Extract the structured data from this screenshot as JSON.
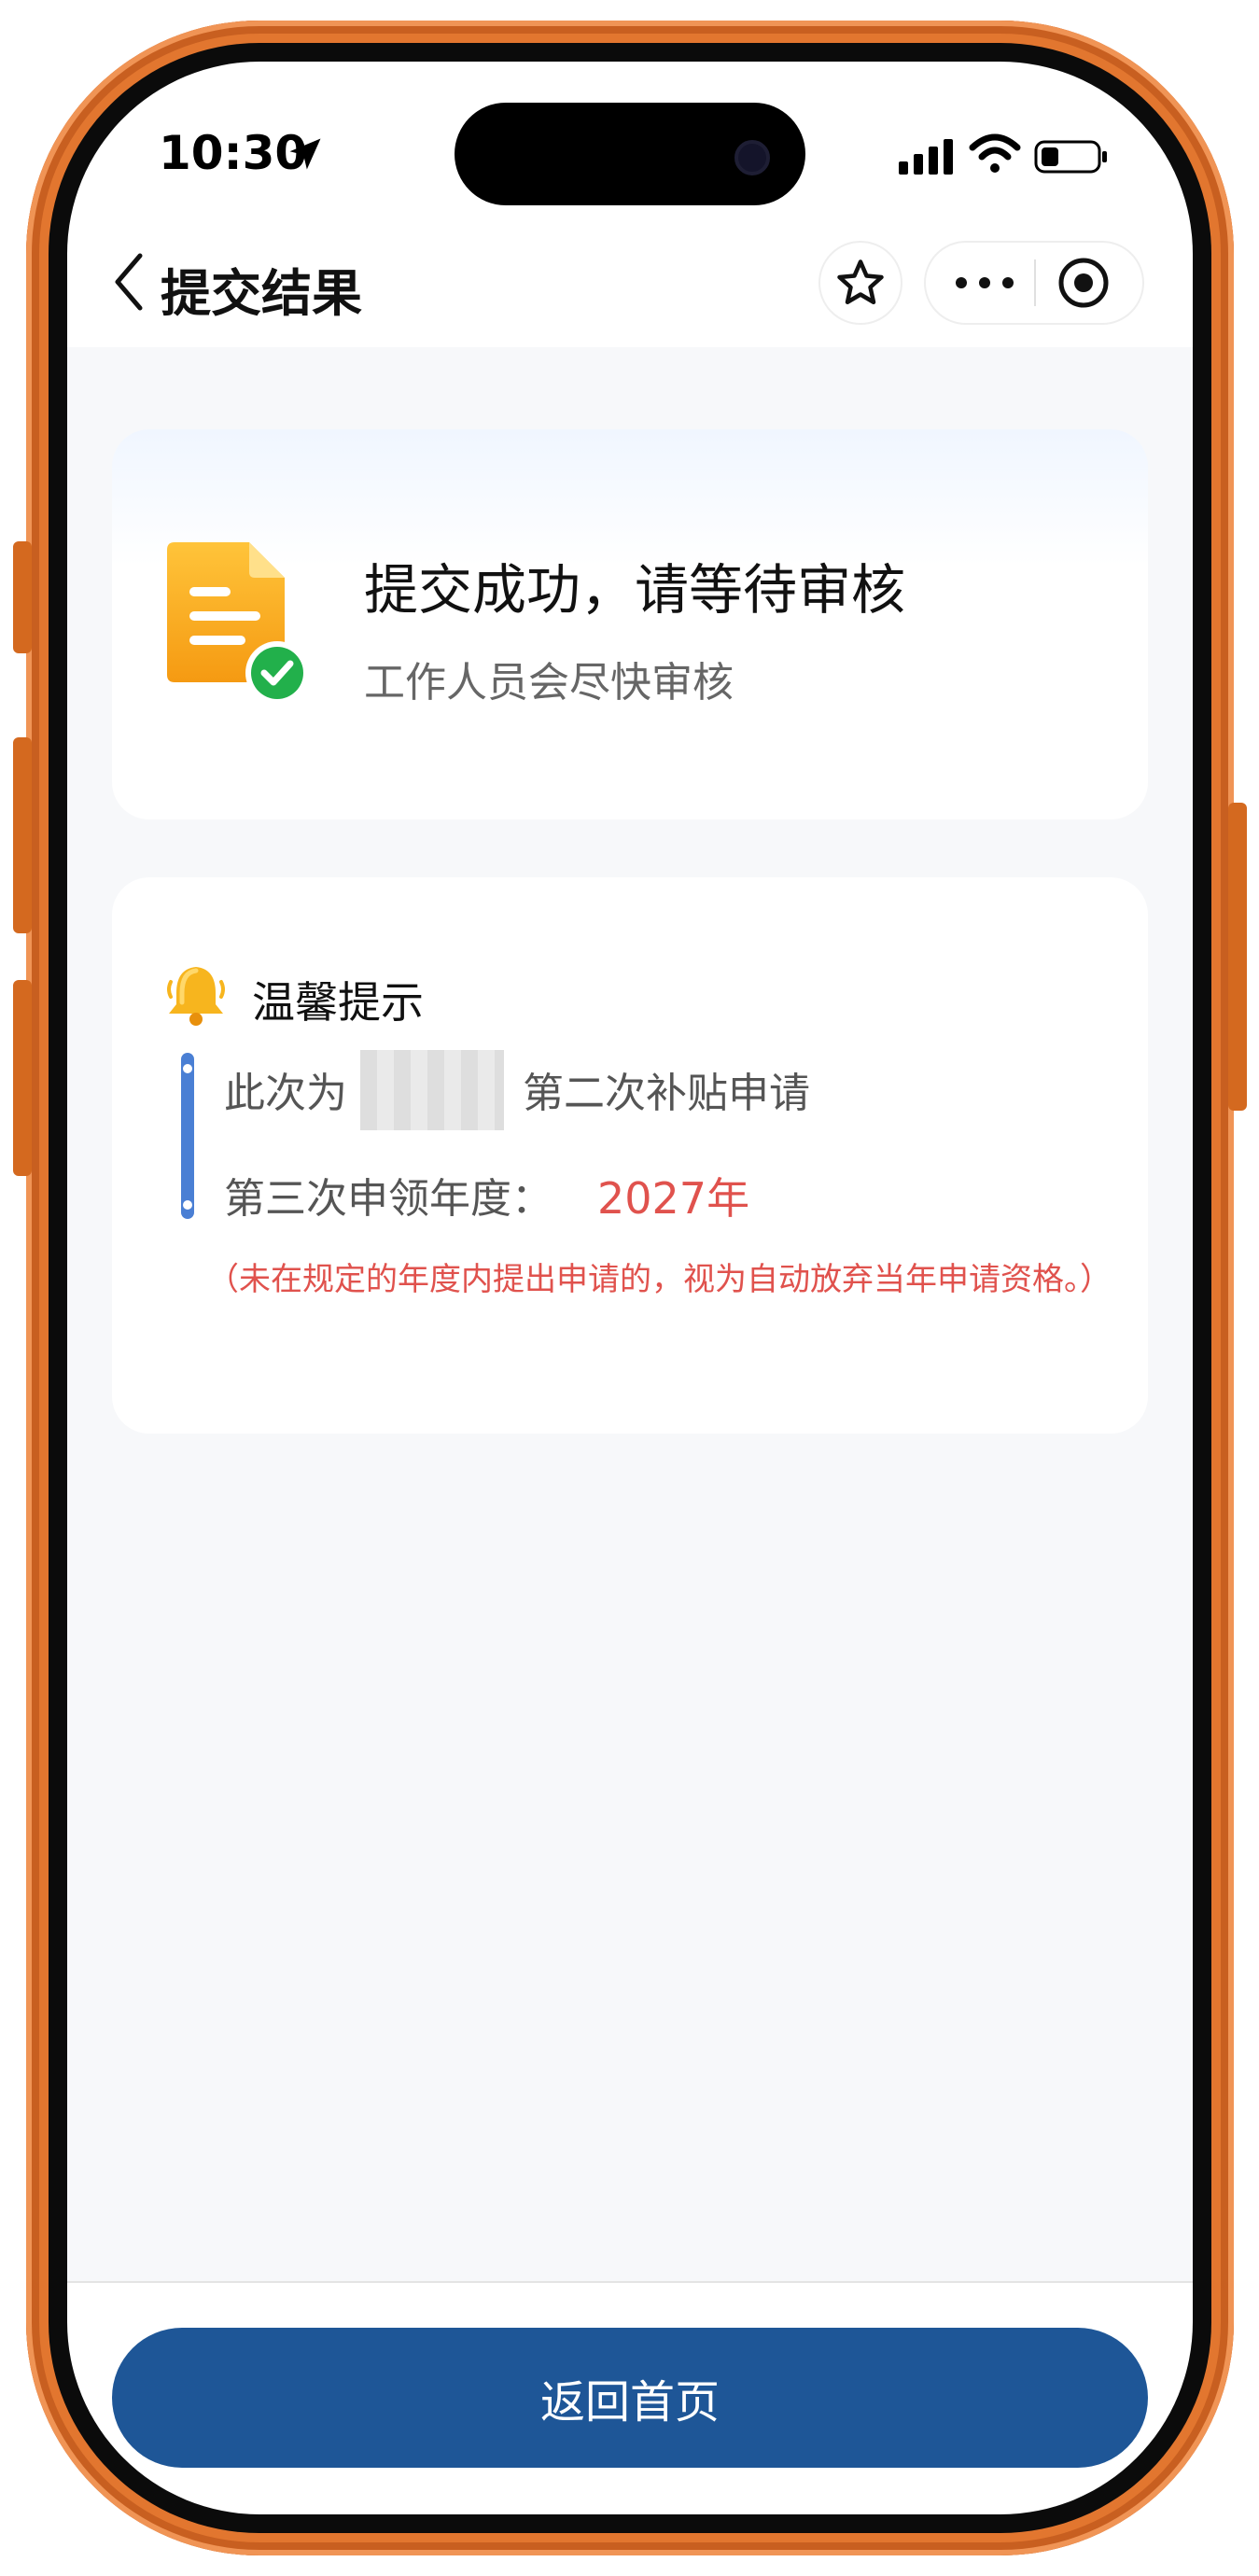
{
  "status_bar": {
    "time": "10:30"
  },
  "nav": {
    "title": "提交结果"
  },
  "result_card": {
    "title": "提交成功，请等待审核",
    "subtitle": "工作人员会尽快审核"
  },
  "tips_card": {
    "title": "温馨提示",
    "line1_prefix": "此次为",
    "line1_suffix": "第二次补贴申请",
    "line2_label": "第三次申领年度：",
    "line2_value": "2027年",
    "note": "（未在规定的年度内提出申请的，视为自动放弃当年申请资格。）"
  },
  "bottom": {
    "home_button": "返回首页"
  },
  "colors": {
    "frame": "#e2762f",
    "primary_button": "#1e5697",
    "accent_red": "#e0524d",
    "scroll_bar": "#4a7fd4",
    "success_green": "#22b04b",
    "doc_orange": "#f5a01e"
  },
  "icons": [
    "location-arrow-icon",
    "signal-icon",
    "wifi-icon",
    "battery-icon",
    "back-arrow-icon",
    "star-icon",
    "more-dots-icon",
    "target-circle-icon",
    "document-check-icon",
    "bell-icon"
  ]
}
